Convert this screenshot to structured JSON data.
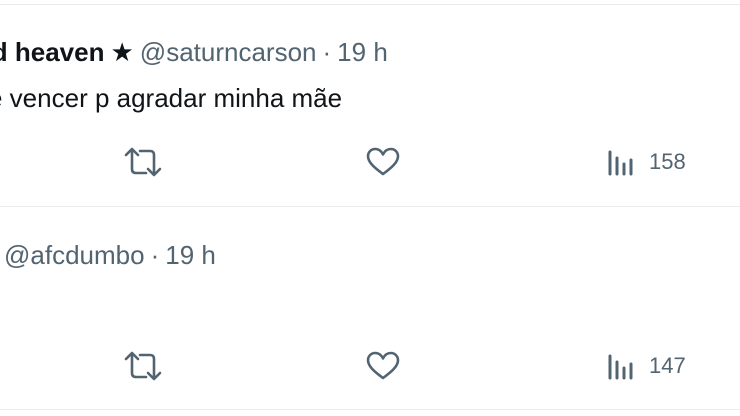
{
  "tweets": [
    {
      "display_name": "und heaven",
      "star": "★",
      "handle": "@saturncarson",
      "separator": "·",
      "time": "19 h",
      "text": "e vencer p agradar minha mãe",
      "views": "158"
    },
    {
      "display_name": "",
      "handle": "@afcdumbo",
      "separator": "·",
      "time": "19 h",
      "text": "",
      "views": "147"
    }
  ],
  "icons": {
    "retweet": "retweet-icon",
    "like": "heart-icon",
    "views": "analytics-icon"
  },
  "colors": {
    "icon": "#536471",
    "text": "#0f1419",
    "divider": "#e9ecef"
  }
}
